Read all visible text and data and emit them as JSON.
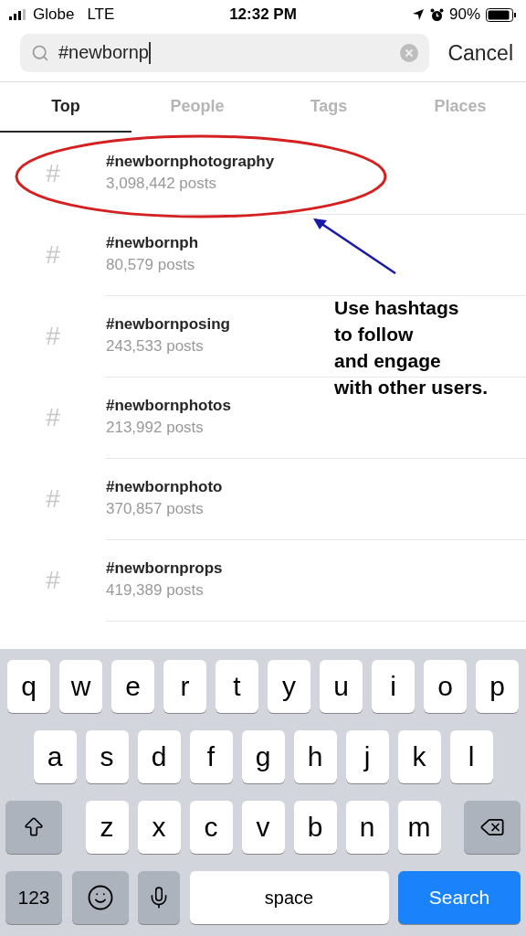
{
  "status_bar": {
    "carrier": "Globe",
    "network": "LTE",
    "time": "12:32 PM",
    "battery": "90%"
  },
  "search": {
    "value": "#newbornp",
    "cancel": "Cancel"
  },
  "tabs": [
    {
      "label": "Top",
      "selected": true
    },
    {
      "label": "People",
      "selected": false
    },
    {
      "label": "Tags",
      "selected": false
    },
    {
      "label": "Places",
      "selected": false
    }
  ],
  "results": [
    {
      "icon": "#",
      "tag": "#newbornphotography",
      "posts": "3,098,442 posts"
    },
    {
      "icon": "#",
      "tag": "#newbornph",
      "posts": "80,579 posts"
    },
    {
      "icon": "#",
      "tag": "#newbornposing",
      "posts": "243,533 posts"
    },
    {
      "icon": "#",
      "tag": "#newbornphotos",
      "posts": "213,992 posts"
    },
    {
      "icon": "#",
      "tag": "#newbornphoto",
      "posts": "370,857 posts"
    },
    {
      "icon": "#",
      "tag": "#newbornprops",
      "posts": "419,389 posts"
    }
  ],
  "annotation": {
    "lines": [
      "Use hashtags",
      "to follow",
      "and engage",
      "with other users."
    ]
  },
  "keyboard": {
    "letter_rows": [
      {
        "keys": [
          {
            "kind": "letter",
            "label": "q"
          },
          {
            "kind": "letter",
            "label": "w"
          },
          {
            "kind": "letter",
            "label": "e"
          },
          {
            "kind": "letter",
            "label": "r"
          },
          {
            "kind": "letter",
            "label": "t"
          },
          {
            "kind": "letter",
            "label": "y"
          },
          {
            "kind": "letter",
            "label": "u"
          },
          {
            "kind": "letter",
            "label": "i"
          },
          {
            "kind": "letter",
            "label": "o"
          },
          {
            "kind": "letter",
            "label": "p"
          }
        ]
      },
      {
        "keys": [
          {
            "kind": "letter",
            "label": "a"
          },
          {
            "kind": "letter",
            "label": "s"
          },
          {
            "kind": "letter",
            "label": "d"
          },
          {
            "kind": "letter",
            "label": "f"
          },
          {
            "kind": "letter",
            "label": "g"
          },
          {
            "kind": "letter",
            "label": "h"
          },
          {
            "kind": "letter",
            "label": "j"
          },
          {
            "kind": "letter",
            "label": "k"
          },
          {
            "kind": "letter",
            "label": "l"
          }
        ]
      },
      {
        "keys": [
          {
            "kind": "shift"
          },
          {
            "kind": "letter",
            "label": "z"
          },
          {
            "kind": "letter",
            "label": "x"
          },
          {
            "kind": "letter",
            "label": "c"
          },
          {
            "kind": "letter",
            "label": "v"
          },
          {
            "kind": "letter",
            "label": "b"
          },
          {
            "kind": "letter",
            "label": "n"
          },
          {
            "kind": "letter",
            "label": "m"
          },
          {
            "kind": "delete"
          }
        ]
      }
    ],
    "bottom_bar": [
      {
        "kind": "mode",
        "label": "123"
      },
      {
        "kind": "emoji"
      },
      {
        "kind": "mic"
      },
      {
        "kind": "space",
        "label": "space"
      },
      {
        "kind": "search",
        "label": "Search"
      }
    ]
  }
}
